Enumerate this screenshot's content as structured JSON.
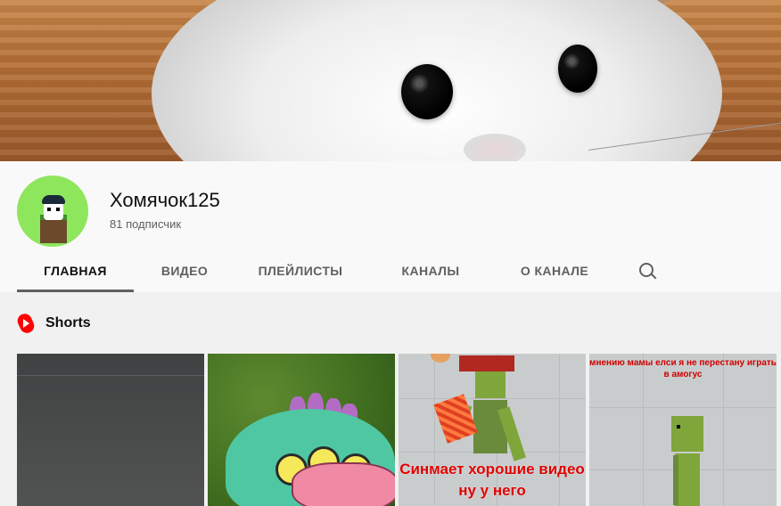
{
  "channel": {
    "name": "Хомячок125",
    "subscribers": "81 подписчик"
  },
  "tabs": [
    {
      "label": "ГЛАВНАЯ",
      "active": true
    },
    {
      "label": "ВИДЕО",
      "active": false
    },
    {
      "label": "ПЛЕЙЛИСТЫ",
      "active": false
    },
    {
      "label": "КАНАЛЫ",
      "active": false
    },
    {
      "label": "О КАНАЛЕ",
      "active": false
    }
  ],
  "shorts": {
    "title": "Shorts",
    "items": [
      {
        "caption": ""
      },
      {
        "caption": ""
      },
      {
        "caption": "Синмает хорошие видео ну у него"
      },
      {
        "caption": "мнению мамы елси я не перестану играть в амогус"
      }
    ]
  },
  "icons": {
    "search": "search-icon",
    "shorts": "shorts-icon"
  },
  "colors": {
    "shorts_red": "#ff0000",
    "active_tab_underline": "#606060",
    "avatar_bg": "#8ee65d"
  }
}
